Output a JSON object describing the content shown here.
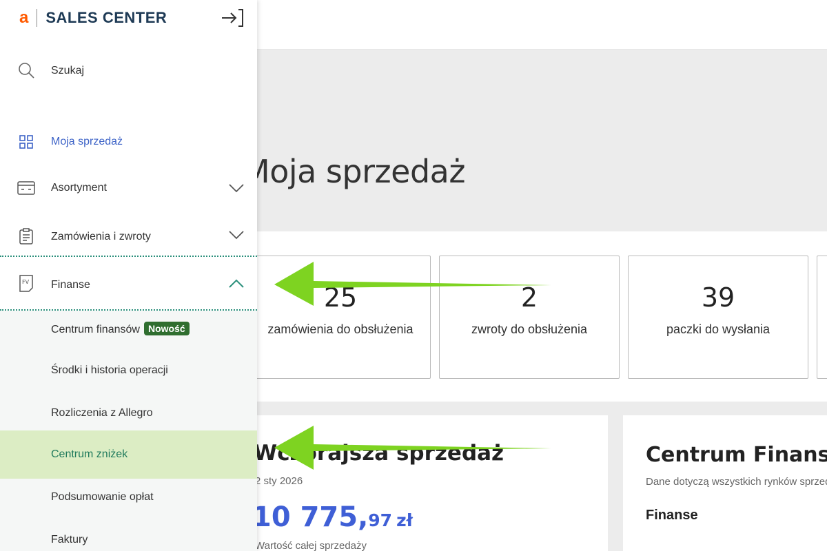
{
  "app": {
    "brand_letter": "a",
    "brand_name": "SALES CENTER"
  },
  "sidebar": {
    "search_label": "Szukaj",
    "items": [
      {
        "label": "Moja sprzedaż",
        "icon": "grid-icon",
        "active": true
      },
      {
        "label": "Asortyment",
        "icon": "box-icon",
        "expandable": true
      },
      {
        "label": "Zamówienia i zwroty",
        "icon": "clipboard-icon",
        "expandable": true
      },
      {
        "label": "Finanse",
        "icon": "invoice-icon",
        "expanded": true
      }
    ],
    "finanse_subitems": [
      {
        "label": "Centrum finansów",
        "badge": "Nowość"
      },
      {
        "label": "Środki i historia operacji"
      },
      {
        "label": "Rozliczenia z Allegro"
      },
      {
        "label": "Centrum zniżek",
        "active": true
      },
      {
        "label": "Podsumowanie opłat"
      },
      {
        "label": "Faktury"
      }
    ]
  },
  "main": {
    "page_title": "Moja sprzedaż",
    "stats": [
      {
        "value": "25",
        "label": "zamówienia do obsłużenia"
      },
      {
        "value": "2",
        "label": "zwroty do obsłużenia"
      },
      {
        "value": "39",
        "label": "paczki do wysłania"
      }
    ],
    "sales_card": {
      "title": "Wczorajsza sprzedaż",
      "date": "2 sty 2026",
      "amount_int": "10 775,",
      "amount_dec": "97",
      "currency": "zł",
      "subtitle": "Wartość całej sprzedaży"
    },
    "finance_card": {
      "title": "Centrum Finansów",
      "description": "Dane dotyczą wszystkich rynków sprzedaży",
      "section": "Finanse"
    }
  },
  "colors": {
    "brand_orange": "#ff5a00",
    "brand_navy": "#1e3a55",
    "link_blue": "#3d63c7",
    "amount_blue": "#3f5fd6",
    "badge_green": "#2f6e2f",
    "active_sub_bg": "#dcedc4",
    "arrow_green": "#7ed321"
  }
}
